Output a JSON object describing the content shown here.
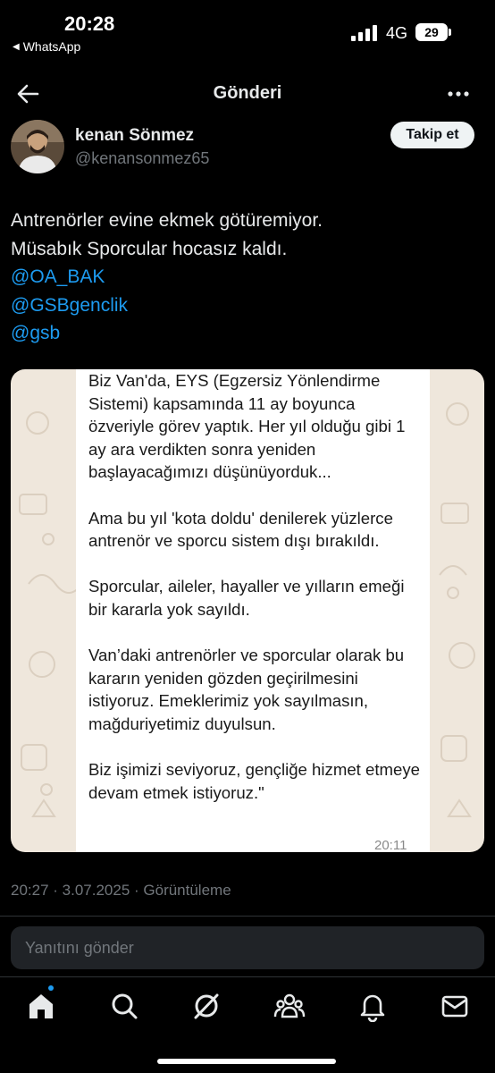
{
  "status_bar": {
    "time": "20:28",
    "back_app": "WhatsApp",
    "network": "4G",
    "battery": "29"
  },
  "header": {
    "title": "Gönderi"
  },
  "author": {
    "name": "kenan Sönmez",
    "handle": "@kenansonmez65",
    "follow_label": "Takip et"
  },
  "post": {
    "line1": "Antrenörler evine ekmek götüremiyor.",
    "line2": "Müsabık Sporcular hocasız kaldı.",
    "mentions": [
      "@OA_BAK",
      "@GSBgenclik",
      "@gsb"
    ]
  },
  "media": {
    "paragraphs": [
      "Biz Van'da, EYS (Egzersiz Yönlendirme Sistemi) kapsamında 11 ay boyunca özveriyle görev yaptık. Her yıl olduğu gibi 1 ay ara verdikten sonra yeniden başlayacağımızı düşünüyorduk...",
      "Ama bu yıl 'kota doldu' denilerek yüzlerce antrenör ve sporcu sistem dışı bırakıldı.",
      "Sporcular, aileler, hayaller ve yılların emeği bir kararla yok sayıldı.",
      "Van’daki antrenörler ve sporcular olarak bu kararın yeniden gözden geçirilmesini istiyoruz. Emeklerimiz yok sayılmasın, mağduriyetimiz duyulsun.",
      "Biz işimizi seviyoruz, gençliğe hizmet etmeye devam etmek istiyoruz.\""
    ],
    "time": "20:11"
  },
  "meta": {
    "text": "20:27 · 3.07.2025 · Görüntüleme"
  },
  "reply": {
    "placeholder": "Yanıtını gönder"
  },
  "nav": {
    "items": [
      "home-icon",
      "search-icon",
      "grok-icon",
      "communities-icon",
      "notifications-icon",
      "messages-icon"
    ]
  },
  "colors": {
    "background": "#000000",
    "link": "#1d9bf0",
    "muted": "#71767b",
    "text": "#e7e9ea"
  }
}
